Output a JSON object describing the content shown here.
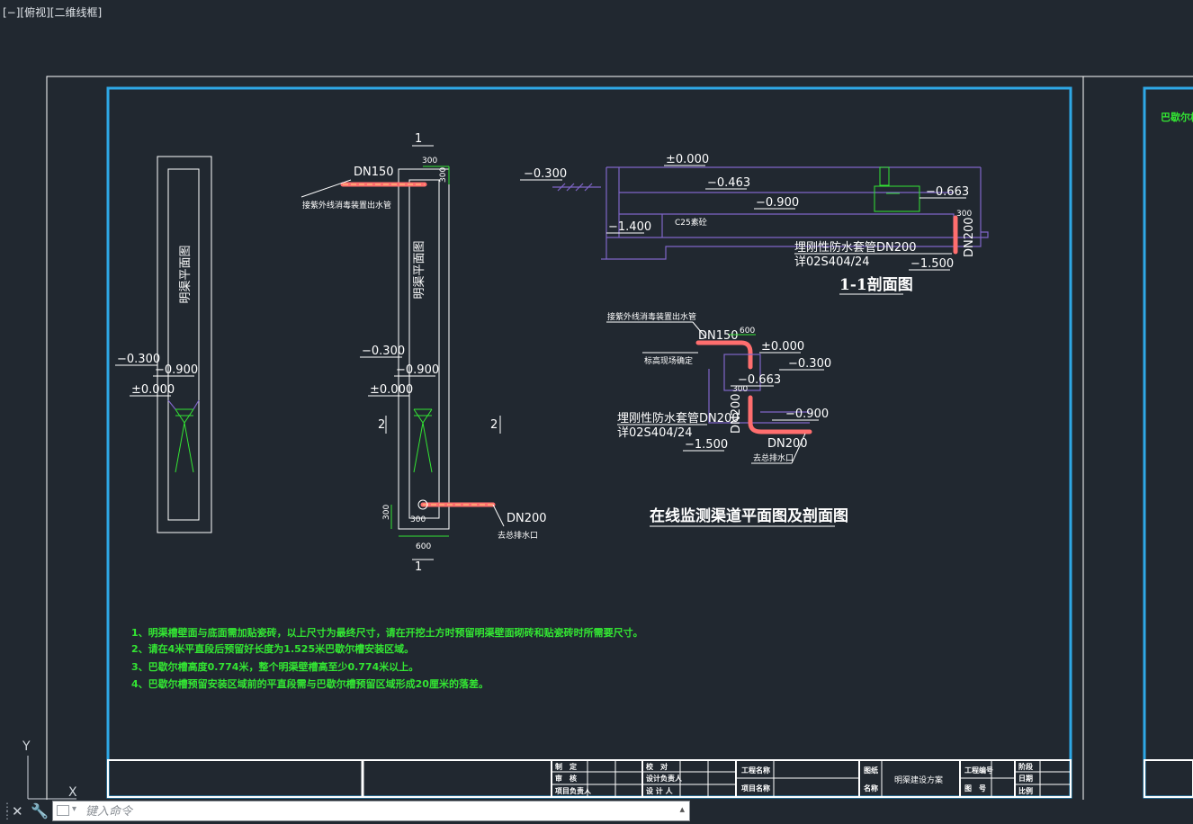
{
  "viewport_label": "[−][俯视][二维线框]",
  "command_line": {
    "placeholder": "键入命令"
  },
  "ucs": {
    "y": "Y",
    "x": "X"
  },
  "colors": {
    "background": "#212830",
    "frame_blue": "#2ea8e6",
    "outline": "#ffffff",
    "structure": "#7f66c8",
    "note_green": "#33e533",
    "pipe": "#ff6e6e"
  },
  "drawing": {
    "plan1_label": "明渠平面图",
    "plan2_label": "明渠平面图",
    "plan1_elev": [
      "−0.300",
      "−0.900",
      "±0.000"
    ],
    "plan2_elev": [
      "−0.300",
      "−0.900",
      "±0.000"
    ],
    "section_marks": [
      "1",
      "1",
      "2",
      "2"
    ],
    "plan2_dn150": "DN150",
    "plan2_uv_note": "接紫外线消毒装置出水管",
    "plan2_dim_top": [
      "300",
      "300"
    ],
    "plan2_dn200": "DN200",
    "plan2_drain": "去总排水口",
    "plan2_dim_bottom": [
      "300",
      "300",
      "600"
    ],
    "section11": {
      "elev": [
        "−0.300",
        "±0.000",
        "−0.463",
        "−0.900",
        "−0.663",
        "−1.400",
        "−1.500"
      ],
      "c25": "C25素砼",
      "dim300": "300",
      "dn200": "DN200",
      "sleeve": "埋刚性防水套管DN200",
      "std": "详02S404/24",
      "title": "1-1剖面图"
    },
    "section22": {
      "uv_note": "接紫外线消毒装置出水管",
      "dn150": "DN150",
      "dim600": "600",
      "elev_note": "标高现场确定",
      "elev": [
        "±0.000",
        "−0.300",
        "−0.663",
        "−0.900",
        "−1.500"
      ],
      "dim300": "300",
      "sleeve": "埋刚性防水套管DN200",
      "std": "详02S404/24",
      "dn200_v": "DN200",
      "dn200_h": "DN200",
      "drain": "去总排水口"
    },
    "main_title": "在线监测渠道平面图及剖面图",
    "notes": [
      "1、明渠槽壁面与底面需加贴瓷砖，以上尺寸为最终尺寸，请在开挖土方时预留明渠壁面砌砖和贴瓷砖时所需要尺寸。",
      "2、请在4米平直段后预留好长度为1.525米巴歇尔槽安装区域。",
      "3、巴歇尔槽高度0.774米，整个明渠壁槽高至少0.774米以上。",
      "4、巴歇尔槽预留安装区域前的平直段需与巴歇尔槽预留区域形成20厘米的落差。"
    ],
    "right_sheet_note": "巴歇尔槽"
  },
  "title_block": {
    "c1": [
      "制　定",
      "审　核",
      "项目负责人"
    ],
    "c2": [
      "校　对",
      "设计负责人",
      "设 计 人"
    ],
    "c3": [
      "工程名称",
      "项目名称"
    ],
    "c4": [
      "图纸",
      "名称"
    ],
    "drawing_name": "明渠建设方案",
    "c5": [
      "工程编号",
      "图　号"
    ],
    "c6": [
      "阶段",
      "日期",
      "比例"
    ]
  }
}
